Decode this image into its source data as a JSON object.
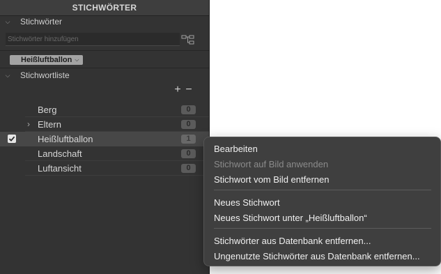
{
  "panel": {
    "title": "STICHWÖRTER",
    "section_keywords": "Stichwörter",
    "search_placeholder": "Stichwörter hinzufügen",
    "filter_chip": "Heißluftballon",
    "section_list": "Stichwortliste",
    "add_symbol": "+",
    "remove_symbol": "−"
  },
  "keywords": [
    {
      "name": "Berg",
      "count": "0"
    },
    {
      "name": "Eltern",
      "count": "0"
    },
    {
      "name": "Heißluftballon",
      "count": "1"
    },
    {
      "name": "Landschaft",
      "count": "0"
    },
    {
      "name": "Luftansicht",
      "count": "0"
    }
  ],
  "context_menu": {
    "items": [
      {
        "label": "Bearbeiten",
        "enabled": true
      },
      {
        "label": "Stichwort auf Bild anwenden",
        "enabled": false
      },
      {
        "label": "Stichwort vom Bild entfernen",
        "enabled": true
      },
      {
        "label": "Neues Stichwort",
        "enabled": true
      },
      {
        "label": "Neues Stichwort unter „Heißluftballon“",
        "enabled": true
      },
      {
        "label": "Stichwörter aus Datenbank entfernen...",
        "enabled": true
      },
      {
        "label": "Ungenutzte Stichwörter aus Datenbank entfernen...",
        "enabled": true
      }
    ]
  },
  "colors": {
    "panel_bg": "#333333",
    "selected_row": "#474747",
    "menu_bg": "#3f3f3f"
  }
}
